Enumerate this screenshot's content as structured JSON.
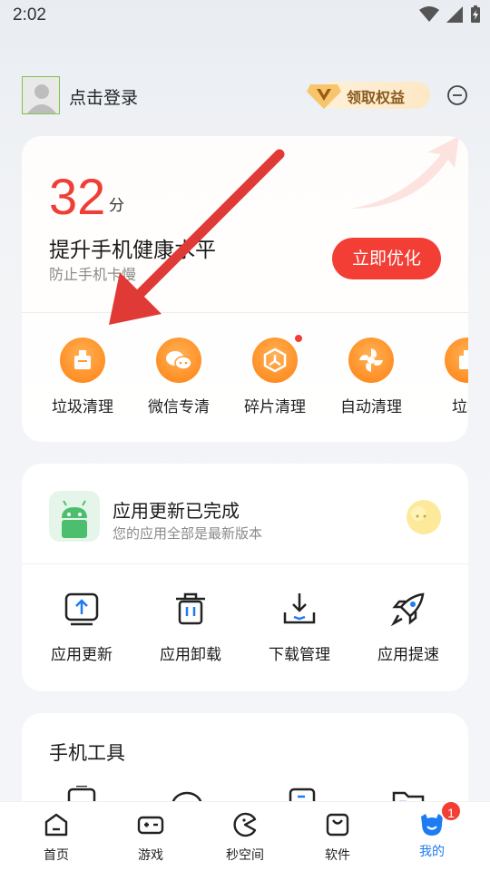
{
  "status_bar": {
    "time": "2:02",
    "icons": [
      "wifi-icon",
      "signal-icon",
      "battery-charging-icon"
    ]
  },
  "profile": {
    "login_label": "点击登录",
    "vip_label": "领取权益",
    "vip_badge": "V"
  },
  "health": {
    "score": "32",
    "score_unit": "分",
    "title": "提升手机健康水平",
    "subtitle": "防止手机卡慢",
    "optimize_label": "立即优化",
    "tools": [
      {
        "label": "垃圾清理",
        "icon": "trash-clean-icon"
      },
      {
        "label": "微信专清",
        "icon": "wechat-icon"
      },
      {
        "label": "碎片清理",
        "icon": "fragment-icon",
        "has_dot": true
      },
      {
        "label": "自动清理",
        "icon": "auto-clean-icon"
      },
      {
        "label": "垃圾",
        "icon": "trash-clean-icon"
      }
    ]
  },
  "update": {
    "title": "应用更新已完成",
    "subtitle": "您的应用全部是最新版本",
    "actions": [
      {
        "label": "应用更新",
        "icon": "update-icon"
      },
      {
        "label": "应用卸载",
        "icon": "uninstall-icon"
      },
      {
        "label": "下载管理",
        "icon": "download-icon"
      },
      {
        "label": "应用提速",
        "icon": "rocket-icon"
      }
    ]
  },
  "phone_tools": {
    "title": "手机工具"
  },
  "nav": {
    "items": [
      {
        "label": "首页",
        "icon": "home-icon"
      },
      {
        "label": "游戏",
        "icon": "gamepad-icon"
      },
      {
        "label": "秒空间",
        "icon": "pacman-icon"
      },
      {
        "label": "软件",
        "icon": "bag-icon"
      },
      {
        "label": "我的",
        "icon": "profile-icon",
        "badge": "1",
        "active": true
      }
    ]
  },
  "colors": {
    "accent_red": "#f23e35",
    "accent_orange": "#ff8a1e",
    "active_blue": "#1e7cf2"
  }
}
